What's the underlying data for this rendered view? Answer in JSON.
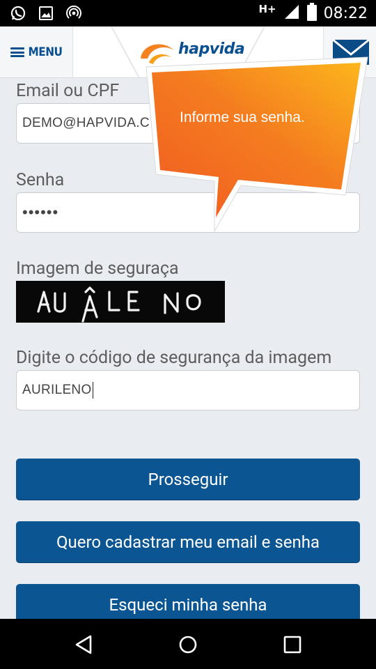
{
  "status_bar": {
    "network": "H+",
    "time": "08:22",
    "icons": [
      "whatsapp-icon",
      "image-icon",
      "hotspot-icon",
      "signal-icon",
      "battery-icon"
    ]
  },
  "header": {
    "menu_label": "MENU",
    "logo_text": "hapvida",
    "icons": [
      "menu-icon",
      "mail-icon"
    ]
  },
  "form": {
    "email": {
      "label": "Email ou CPF",
      "value": "DEMO@HAPVIDA.C"
    },
    "password": {
      "label": "Senha",
      "value": "••••••"
    },
    "captcha": {
      "label": "Imagem de seguraça",
      "image_text": "AU ÂLE ИO"
    },
    "code": {
      "label": "Digite o código de segurança da imagem",
      "value": "AURILENO"
    }
  },
  "tooltip": {
    "text": "Informe sua senha."
  },
  "buttons": {
    "proceed": "Prosseguir",
    "register": "Quero cadastrar meu email e senha",
    "forgot": "Esqueci minha senha"
  },
  "colors": {
    "brand_blue": "#0b5593",
    "tooltip_orange": "#f47a1f",
    "tooltip_yellow": "#fbb21b"
  },
  "nav_bar": {
    "icons": [
      "back-icon",
      "home-icon",
      "recents-icon"
    ]
  }
}
